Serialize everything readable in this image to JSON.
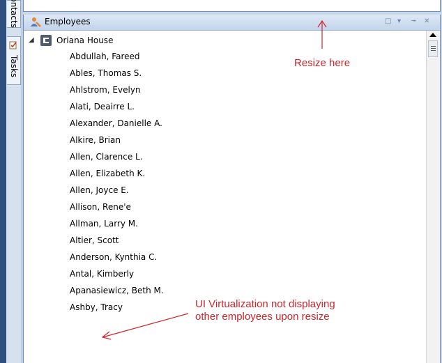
{
  "sidebar": {
    "tabs": [
      {
        "label": "Contacts"
      },
      {
        "label": "Tasks"
      }
    ]
  },
  "panel": {
    "title": "Employees",
    "header_buttons": [
      "window-position-icon",
      "dropdown-arrow-icon",
      "pin-icon",
      "close-icon"
    ]
  },
  "tree": {
    "root": "Oriana House",
    "employees": [
      "Abdullah, Fareed",
      "Ables, Thomas S.",
      "Ahlstrom, Evelyn",
      "Alati, Deairre L.",
      "Alexander, Danielle A.",
      "Alkire, Brian",
      "Allen, Clarence L.",
      "Allen, Elizabeth K.",
      "Allen, Joyce E.",
      "Allison, Rene'e",
      "Allman, Larry M.",
      "Altier, Scott",
      "Anderson, Kynthia C.",
      "Antal, Kimberly",
      "Apanasiewicz, Beth M.",
      "Ashby, Tracy"
    ]
  },
  "annotations": {
    "resize_note": "Resize here",
    "virtualization_note_line1": "UI Virtualization not displaying",
    "virtualization_note_line2": "other employees upon resize",
    "color": "#d2232a"
  }
}
